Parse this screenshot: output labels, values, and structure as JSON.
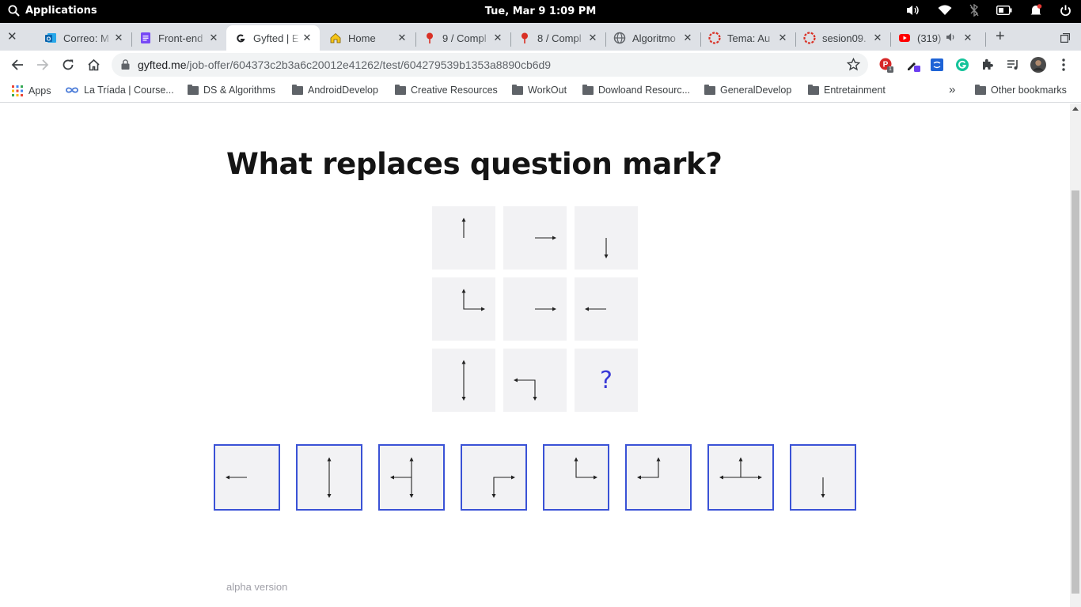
{
  "os": {
    "menu_label": "Applications",
    "clock": "Tue, Mar  9    1:09 PM",
    "tray_icons": [
      "volume-icon",
      "wifi-icon",
      "bluetooth-off-icon",
      "battery-icon",
      "notification-icon",
      "power-icon"
    ]
  },
  "tabs": [
    {
      "title": "Correo: M",
      "icon": "outlook-icon",
      "active": false
    },
    {
      "title": "Front-end",
      "icon": "docs-icon",
      "active": false
    },
    {
      "title": "Gyfted | E",
      "icon": "gyfted-icon",
      "active": true
    },
    {
      "title": "Home",
      "icon": "home-icon",
      "active": false
    },
    {
      "title": "9 / Compl",
      "icon": "pin-icon",
      "active": false
    },
    {
      "title": "8 / Compl",
      "icon": "pin-icon",
      "active": false
    },
    {
      "title": "Algoritmo",
      "icon": "globe-icon",
      "active": false
    },
    {
      "title": "Tema: Au",
      "icon": "moodle-icon",
      "active": false
    },
    {
      "title": "sesion09.",
      "icon": "moodle-icon",
      "active": false
    },
    {
      "title": "(319)",
      "icon": "youtube-icon",
      "active": false
    }
  ],
  "address": {
    "domain": "gyfted.me",
    "path": "/job-offer/604373c2b3a6c20012e41262/test/604279539b1353a8890cb6d9"
  },
  "extensions": {
    "badge_count": "1"
  },
  "bookmarks": {
    "apps": "Apps",
    "items": [
      "La Tríada | Course...",
      "DS & Algorithms",
      "AndroidDevelop",
      "Creative Resources",
      "WorkOut",
      "Dowloand Resourc...",
      "GeneralDevelop",
      "Entretainment"
    ],
    "overflow": "»",
    "other": "Other bookmarks"
  },
  "quiz": {
    "question": "What replaces question mark?",
    "question_mark": "?",
    "grid_cells": [
      {
        "row": 1,
        "col": 1,
        "figure": "arrow-up"
      },
      {
        "row": 1,
        "col": 2,
        "figure": "arrow-right"
      },
      {
        "row": 1,
        "col": 3,
        "figure": "arrow-down"
      },
      {
        "row": 2,
        "col": 1,
        "figure": "corner-up-right"
      },
      {
        "row": 2,
        "col": 2,
        "figure": "arrow-right"
      },
      {
        "row": 2,
        "col": 3,
        "figure": "arrow-left"
      },
      {
        "row": 3,
        "col": 1,
        "figure": "arrow-up-down"
      },
      {
        "row": 3,
        "col": 2,
        "figure": "corner-left-down"
      },
      {
        "row": 3,
        "col": 3,
        "figure": "unknown"
      }
    ],
    "answer_options": [
      {
        "index": 1,
        "figure": "arrow-left"
      },
      {
        "index": 2,
        "figure": "arrow-up-down"
      },
      {
        "index": 3,
        "figure": "t-left-up-down"
      },
      {
        "index": 4,
        "figure": "corner-right-down"
      },
      {
        "index": 5,
        "figure": "corner-up-right"
      },
      {
        "index": 6,
        "figure": "corner-up-left"
      },
      {
        "index": 7,
        "figure": "t-left-right-up"
      },
      {
        "index": 8,
        "figure": "arrow-down"
      }
    ],
    "footer": "alpha version"
  },
  "colors": {
    "accent": "#3a52d6",
    "question_mark": "#3a3ad6",
    "cell_bg": "#f2f2f4",
    "title": "#141414"
  }
}
